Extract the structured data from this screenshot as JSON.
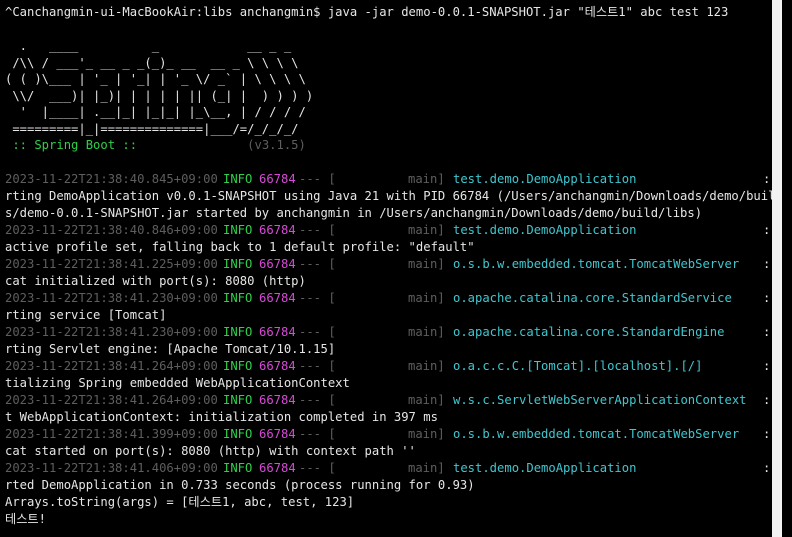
{
  "terminal": {
    "command_line": "^Canchangmin-ui-MacBookAir:libs anchangmin$ java -jar demo-0.0.1-SNAPSHOT.jar \"테스트1\" abc test 123",
    "banner": [
      "  .   ____          _            __ _ _",
      " /\\\\ / ___'_ __ _ _(_)_ __  __ _ \\ \\ \\ \\",
      "( ( )\\___ | '_ | '_| | '_ \\/ _` | \\ \\ \\ \\",
      " \\\\/  ___)| |_)| | | | | || (_| |  ) ) ) )",
      "  '  |____| .__|_| |_|_| |_\\__, | / / / /",
      " =========|_|==============|___/=/_/_/_/"
    ],
    "spring_label": " :: Spring Boot :: ",
    "spring_version": "              (v3.1.5)",
    "log_entries": [
      {
        "timestamp": "2023-11-22T21:38:40.845+09:00",
        "level": "INFO",
        "pid": "66784",
        "separator": "--- [",
        "thread": "main]",
        "logger": "test.demo.DemoApplication",
        "colon_text": ": Sta",
        "continuation": [
          "rting DemoApplication v0.0.1-SNAPSHOT using Java 21 with PID 66784 (/Users/anchangmin/Downloads/demo/build/lib",
          "s/demo-0.0.1-SNAPSHOT.jar started by anchangmin in /Users/anchangmin/Downloads/demo/build/libs)"
        ]
      },
      {
        "timestamp": "2023-11-22T21:38:40.846+09:00",
        "level": "INFO",
        "pid": "66784",
        "separator": "--- [",
        "thread": "main]",
        "logger": "test.demo.DemoApplication",
        "colon_text": ": No",
        "continuation": [
          "active profile set, falling back to 1 default profile: \"default\""
        ]
      },
      {
        "timestamp": "2023-11-22T21:38:41.225+09:00",
        "level": "INFO",
        "pid": "66784",
        "separator": "--- [",
        "thread": "main]",
        "logger": "o.s.b.w.embedded.tomcat.TomcatWebServer",
        "colon_text": ": Tom",
        "continuation": [
          "cat initialized with port(s): 8080 (http)"
        ]
      },
      {
        "timestamp": "2023-11-22T21:38:41.230+09:00",
        "level": "INFO",
        "pid": "66784",
        "separator": "--- [",
        "thread": "main]",
        "logger": "o.apache.catalina.core.StandardService",
        "colon_text": ": Sta",
        "continuation": [
          "rting service [Tomcat]"
        ]
      },
      {
        "timestamp": "2023-11-22T21:38:41.230+09:00",
        "level": "INFO",
        "pid": "66784",
        "separator": "--- [",
        "thread": "main]",
        "logger": "o.apache.catalina.core.StandardEngine",
        "colon_text": ": Sta",
        "continuation": [
          "rting Servlet engine: [Apache Tomcat/10.1.15]"
        ]
      },
      {
        "timestamp": "2023-11-22T21:38:41.264+09:00",
        "level": "INFO",
        "pid": "66784",
        "separator": "--- [",
        "thread": "main]",
        "logger": "o.a.c.c.C.[Tomcat].[localhost].[/]",
        "colon_text": ": Ini",
        "continuation": [
          "tializing Spring embedded WebApplicationContext"
        ]
      },
      {
        "timestamp": "2023-11-22T21:38:41.264+09:00",
        "level": "INFO",
        "pid": "66784",
        "separator": "--- [",
        "thread": "main]",
        "logger": "w.s.c.ServletWebServerApplicationContext",
        "colon_text": ": Roo",
        "continuation": [
          "t WebApplicationContext: initialization completed in 397 ms"
        ]
      },
      {
        "timestamp": "2023-11-22T21:38:41.399+09:00",
        "level": "INFO",
        "pid": "66784",
        "separator": "--- [",
        "thread": "main]",
        "logger": "o.s.b.w.embedded.tomcat.TomcatWebServer",
        "colon_text": ": Tom",
        "continuation": [
          "cat started on port(s): 8080 (http) with context path ''"
        ]
      },
      {
        "timestamp": "2023-11-22T21:38:41.406+09:00",
        "level": "INFO",
        "pid": "66784",
        "separator": "--- [",
        "thread": "main]",
        "logger": "test.demo.DemoApplication",
        "colon_text": ": Sta",
        "continuation": [
          "rted DemoApplication in 0.733 seconds (process running for 0.93)"
        ]
      }
    ],
    "output_lines": [
      "Arrays.toString(args) = [테스트1, abc, test, 123]",
      "테스트!"
    ],
    "colors": {
      "background": "#000000",
      "text": "#e6e6e6",
      "dim": "#5e5e5e",
      "info_level": "#2fcf4a",
      "pid": "#d64bd6",
      "logger": "#3fc7cf",
      "spring_label": "#2fcf4a"
    }
  }
}
